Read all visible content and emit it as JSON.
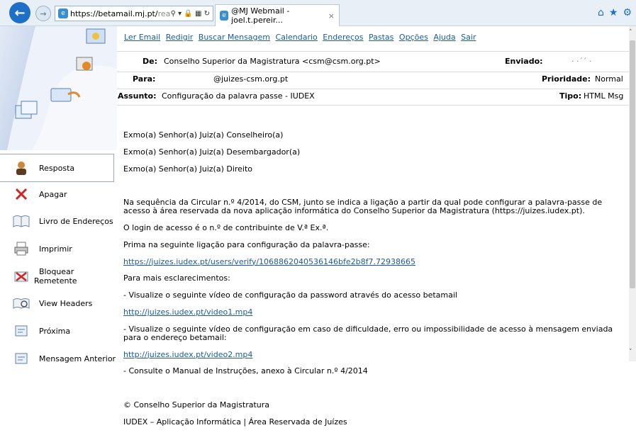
{
  "browser": {
    "url_host": "https://betamail.mj.pt/",
    "url_rest": "rea",
    "tab_title": "@MJ Webmail - joel.t.pereir...",
    "tab_close": "×"
  },
  "nav_links": [
    "Ler Email",
    "Redigir",
    "Buscar Mensagem",
    "Calendario",
    "Endereços",
    "Pastas",
    "Opções",
    "Ajuda",
    "Sair"
  ],
  "actions": [
    {
      "label": "Resposta",
      "icon": "reply-person-icon"
    },
    {
      "label": "Apagar",
      "icon": "delete-x-icon"
    },
    {
      "label": "Livro de Endereços",
      "icon": "address-book-icon"
    },
    {
      "label": "Imprimir",
      "icon": "printer-icon"
    },
    {
      "label": "Bloquear Remetente",
      "icon": "block-sender-icon"
    },
    {
      "label": "View Headers",
      "icon": "view-headers-icon"
    },
    {
      "label": "Próxima",
      "icon": "next-message-icon"
    },
    {
      "label": "Mensagem Anterior",
      "icon": "previous-message-icon"
    }
  ],
  "header": {
    "from_label": "De:",
    "from_value": "Conselho Superior da Magistratura <csm@csm.org.pt>",
    "sent_label": "Enviado:",
    "sent_value": "· ·´´ ·",
    "to_label": "Para:",
    "to_value": "@juizes-csm.org.pt",
    "priority_label": "Prioridade:",
    "priority_value": "Normal",
    "subject_label": "Assunto:",
    "subject_value": "Configuração da palavra passe - IUDEX",
    "type_label": "Tipo:",
    "type_value": "HTML Msg"
  },
  "body": {
    "greet1": "Exmo(a) Senhor(a) Juiz(a) Conselheiro(a)",
    "greet2": "Exmo(a) Senhor(a) Juiz(a) Desembargador(a)",
    "greet3": "Exmo(a) Senhor(a) Juiz(a) Direito",
    "p1": "Na sequência da Circular n.º 4/2014, do CSM, junto se indica a ligação a partir da qual pode configurar a palavra-passe de acesso à área reservada da nova aplicação informática do Conselho Superior da Magistratura (https://juizes.iudex.pt).",
    "p2": "O login de acesso é o n.º de contribuinte de V.ª Ex.ª.",
    "p3": "Prima na seguinte ligação para configuração da palavra-passe:",
    "link1": "https://juizes.iudex.pt/users/verify/1068862040536146bfe2b8f7.72938665",
    "p4": "Para mais esclarecimentos:",
    "p5": "- Visualize o seguinte vídeo de configuração da password através do acesso betamail",
    "link2": "http://juizes.iudex.pt/video1.mp4",
    "p6": "- Visualize o seguinte vídeo de configuração em caso de dificuldade, erro ou impossibilidade de acesso à mensagem enviada para o endereço betamail:",
    "link3": "http://juizes.iudex.pt/video2.mp4",
    "p7": "- Consulte o Manual de Instruções, anexo à Circular n.º 4/2014",
    "sig1": "© Conselho Superior da Magistratura",
    "sig2": "IUDEX – Aplicação Informática | Área Reservada de Juízes"
  }
}
